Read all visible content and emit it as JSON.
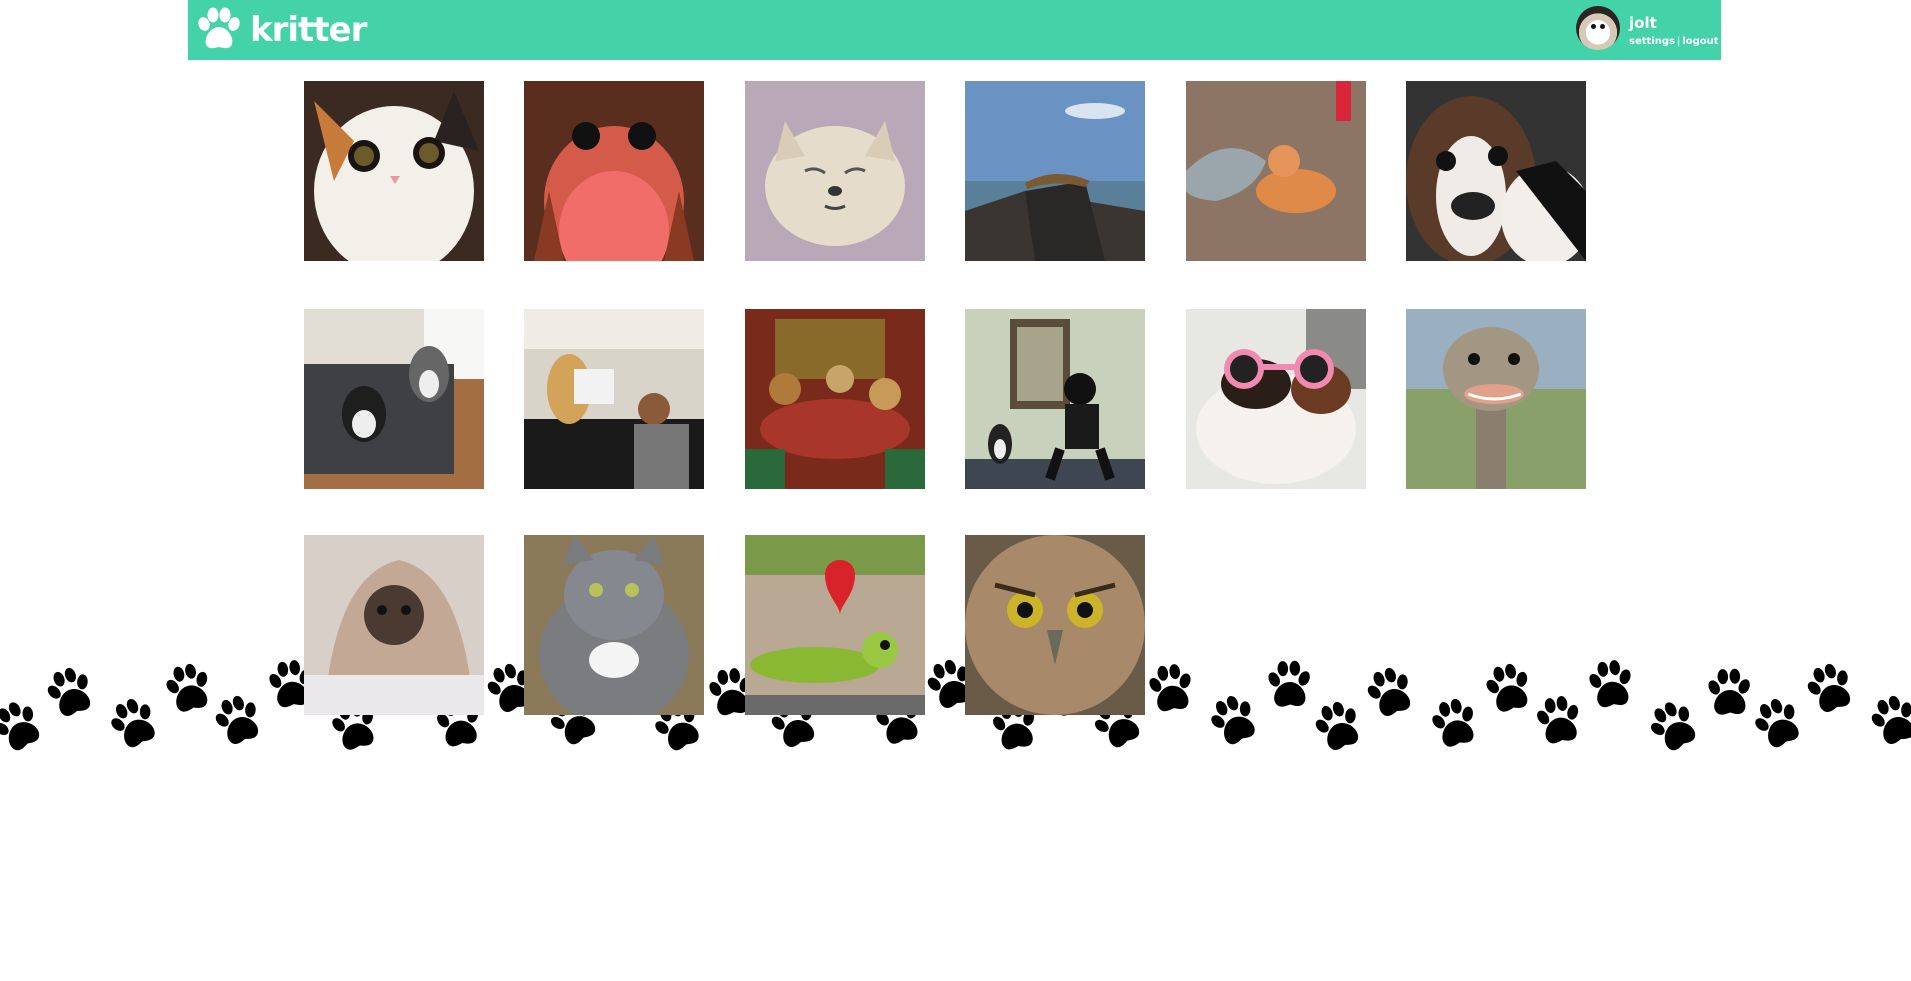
{
  "header": {
    "brand": "kritter",
    "username": "jolt",
    "settings_label": "settings",
    "separator": "|",
    "logout_label": "logout",
    "background_color": "#44d3a9"
  },
  "gallery": {
    "images": [
      {
        "subject": "calico kitten with big eyes",
        "icon": "cat-image"
      },
      {
        "subject": "porg creature",
        "icon": "porg-image"
      },
      {
        "subject": "sleepy white dog",
        "icon": "dog-image"
      },
      {
        "subject": "iguana on rock at beach",
        "icon": "iguana-image"
      },
      {
        "subject": "kitten with plush shark",
        "icon": "cat-image"
      },
      {
        "subject": "two boston terriers close up",
        "icon": "dog-image"
      },
      {
        "subject": "dog and cat on couch",
        "icon": "pets-image"
      },
      {
        "subject": "dog reading newspaper in kitchen",
        "icon": "dog-image"
      },
      {
        "subject": "dogs playing poker painting",
        "icon": "painting-image"
      },
      {
        "subject": "dog and person squatting",
        "icon": "dog-image"
      },
      {
        "subject": "guinea pig with pink sunglasses",
        "icon": "guinea-pig-image"
      },
      {
        "subject": "smiling ostrich",
        "icon": "ostrich-image"
      },
      {
        "subject": "pug wrapped in blanket",
        "icon": "dog-image"
      },
      {
        "subject": "grey cat",
        "icon": "cat-image"
      },
      {
        "subject": "frog figurine holding heart",
        "icon": "frog-image"
      },
      {
        "subject": "owl close up",
        "icon": "owl-image"
      }
    ]
  }
}
